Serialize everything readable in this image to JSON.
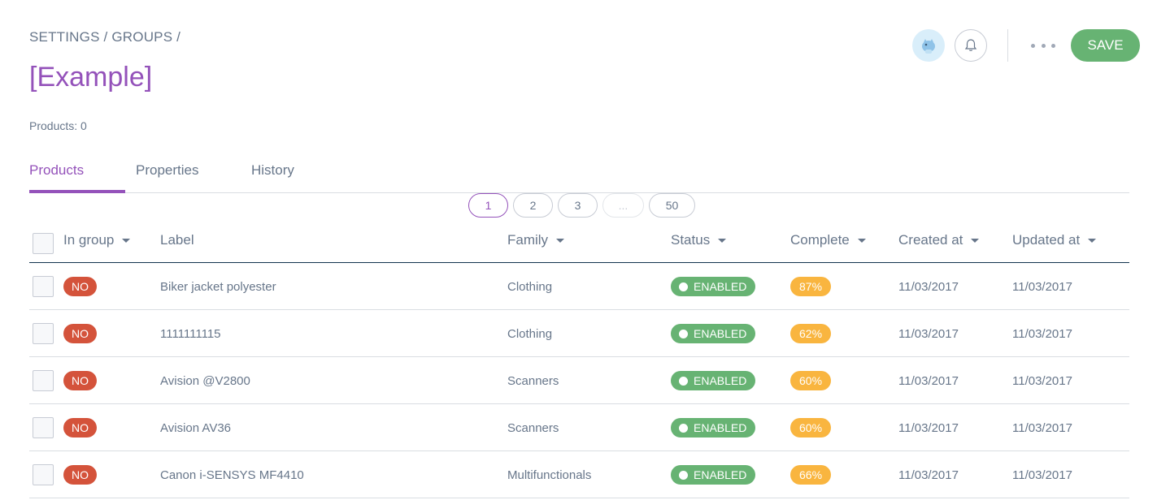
{
  "breadcrumb": "SETTINGS / GROUPS /",
  "title": "[Example]",
  "products_count": "Products: 0",
  "actions": {
    "save_label": "SAVE"
  },
  "tabs": [
    {
      "label": "Products",
      "active": true
    },
    {
      "label": "Properties",
      "active": false
    },
    {
      "label": "History",
      "active": false
    }
  ],
  "pagination": [
    "1",
    "2",
    "3",
    "...",
    "50"
  ],
  "columns": [
    "In group",
    "Label",
    "Family",
    "Status",
    "Complete",
    "Created at",
    "Updated at"
  ],
  "rows": [
    {
      "in_group": "NO",
      "label": "Biker jacket polyester",
      "family": "Clothing",
      "status": "ENABLED",
      "complete": "87%",
      "created": "11/03/2017",
      "updated": "11/03/2017"
    },
    {
      "in_group": "NO",
      "label": "1111111115",
      "family": "Clothing",
      "status": "ENABLED",
      "complete": "62%",
      "created": "11/03/2017",
      "updated": "11/03/2017"
    },
    {
      "in_group": "NO",
      "label": "Avision @V2800",
      "family": "Scanners",
      "status": "ENABLED",
      "complete": "60%",
      "created": "11/03/2017",
      "updated": "11/03/2017"
    },
    {
      "in_group": "NO",
      "label": "Avision AV36",
      "family": "Scanners",
      "status": "ENABLED",
      "complete": "60%",
      "created": "11/03/2017",
      "updated": "11/03/2017"
    },
    {
      "in_group": "NO",
      "label": "Canon i-SENSYS MF4410",
      "family": "Multifunctionals",
      "status": "ENABLED",
      "complete": "66%",
      "created": "11/03/2017",
      "updated": "11/03/2017"
    }
  ],
  "colors": {
    "accent": "#9452ba",
    "enabled": "#67b373",
    "no": "#d4533b",
    "complete": "#f9b53f",
    "text": "#67768a"
  }
}
